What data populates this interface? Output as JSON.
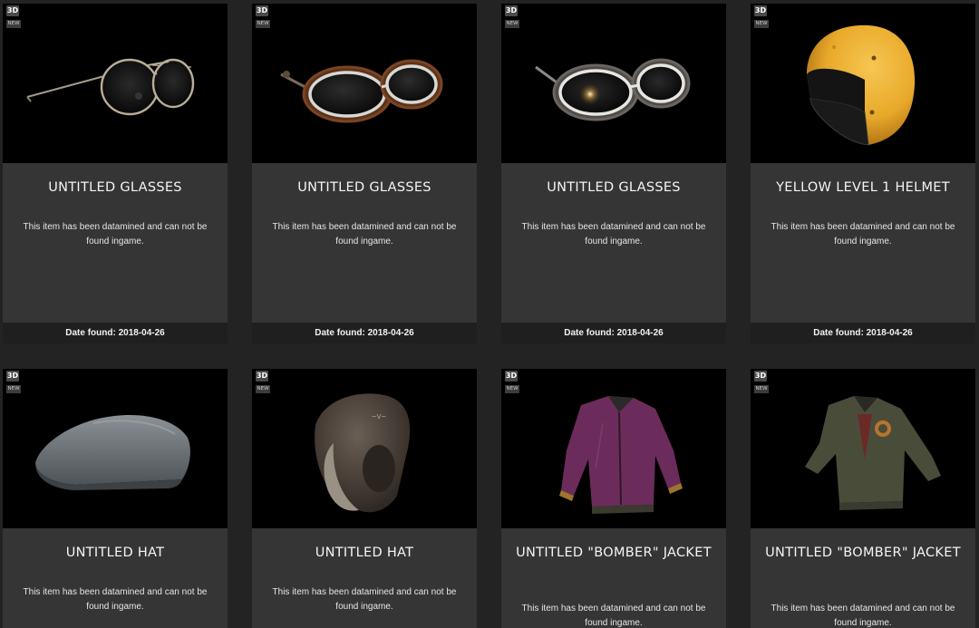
{
  "items": [
    {
      "badge_3d": "3D",
      "badge_new": "NEW",
      "name": "UNTITLED GLASSES",
      "description": "This item has been datamined and can not be found ingame.",
      "date_found": "Date found: 2018-04-26",
      "icon": "round-glasses-icon"
    },
    {
      "badge_3d": "3D",
      "badge_new": "NEW",
      "name": "UNTITLED GLASSES",
      "description": "This item has been datamined and can not be found ingame.",
      "date_found": "Date found: 2018-04-26",
      "icon": "leather-goggles-icon"
    },
    {
      "badge_3d": "3D",
      "badge_new": "NEW",
      "name": "UNTITLED GLASSES",
      "description": "This item has been datamined and can not be found ingame.",
      "date_found": "Date found: 2018-04-26",
      "icon": "grey-goggles-icon"
    },
    {
      "badge_3d": "3D",
      "badge_new": "NEW",
      "name": "YELLOW LEVEL 1 HELMET",
      "description": "This item has been datamined and can not be found ingame.",
      "date_found": "Date found: 2018-04-26",
      "icon": "yellow-helmet-icon"
    },
    {
      "badge_3d": "3D",
      "badge_new": "NEW",
      "name": "UNTITLED HAT",
      "description": "This item has been datamined and can not be found ingame.",
      "icon": "flat-cap-icon"
    },
    {
      "badge_3d": "3D",
      "badge_new": "NEW",
      "name": "UNTITLED HAT",
      "description": "This item has been datamined and can not be found ingame.",
      "icon": "aviator-hat-icon"
    },
    {
      "badge_3d": "3D",
      "badge_new": "NEW",
      "name": "UNTITLED \"BOMBER\" JACKET",
      "description": "This item has been datamined and can not be found ingame.",
      "icon": "purple-bomber-jacket-icon"
    },
    {
      "badge_3d": "3D",
      "badge_new": "NEW",
      "name": "UNTITLED \"BOMBER\" JACKET",
      "description": "This item has been datamined and can not be found ingame.",
      "icon": "olive-bomber-jacket-icon"
    }
  ],
  "colors": {
    "page_bg": "#232323",
    "card_bg": "#353535",
    "image_bg": "#000000",
    "footer_bg": "#1f1f1f",
    "helmet_yellow": "#e8a92a"
  }
}
